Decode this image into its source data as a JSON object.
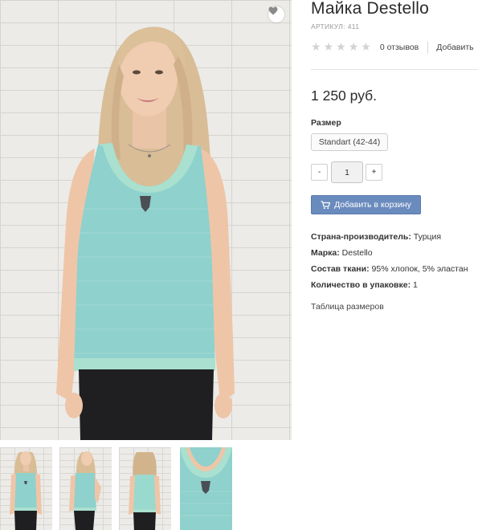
{
  "product": {
    "title": "Майка Destello",
    "sku_label": "АРТИКУЛ:",
    "sku_value": "411",
    "rating": {
      "stars": [
        "★",
        "★",
        "★",
        "★",
        "★"
      ],
      "value": 0,
      "reviews_text": "0 отзывов",
      "add_review_text": "Добавить"
    },
    "price": "1 250 руб.",
    "size": {
      "label": "Размер",
      "selected": "Standart (42-44)"
    },
    "quantity": {
      "minus": "-",
      "value": "1",
      "plus": "+"
    },
    "cart_button": "Добавить в корзину",
    "properties": [
      {
        "name": "Страна-производитель:",
        "value": "Турция"
      },
      {
        "name": "Марка:",
        "value": "Destello"
      },
      {
        "name": "Состав ткани:",
        "value": "95% хлопок, 5% эластан"
      },
      {
        "name": "Количество в упаковке:",
        "value": "1"
      }
    ],
    "size_table_link": "Таблица размеров"
  },
  "gallery": {
    "main_image": "model-in-mint-sequin-tank-top",
    "thumbnails": [
      "front-view",
      "side-view",
      "back-view",
      "fabric-closeup"
    ],
    "wishlist_icon": "heart-icon"
  },
  "colors": {
    "button_blue": "#6a8bbd",
    "top_mint": "#8fd1cc",
    "trim_mint": "#a9e0cf",
    "stars_gray": "#d2d2d2"
  }
}
